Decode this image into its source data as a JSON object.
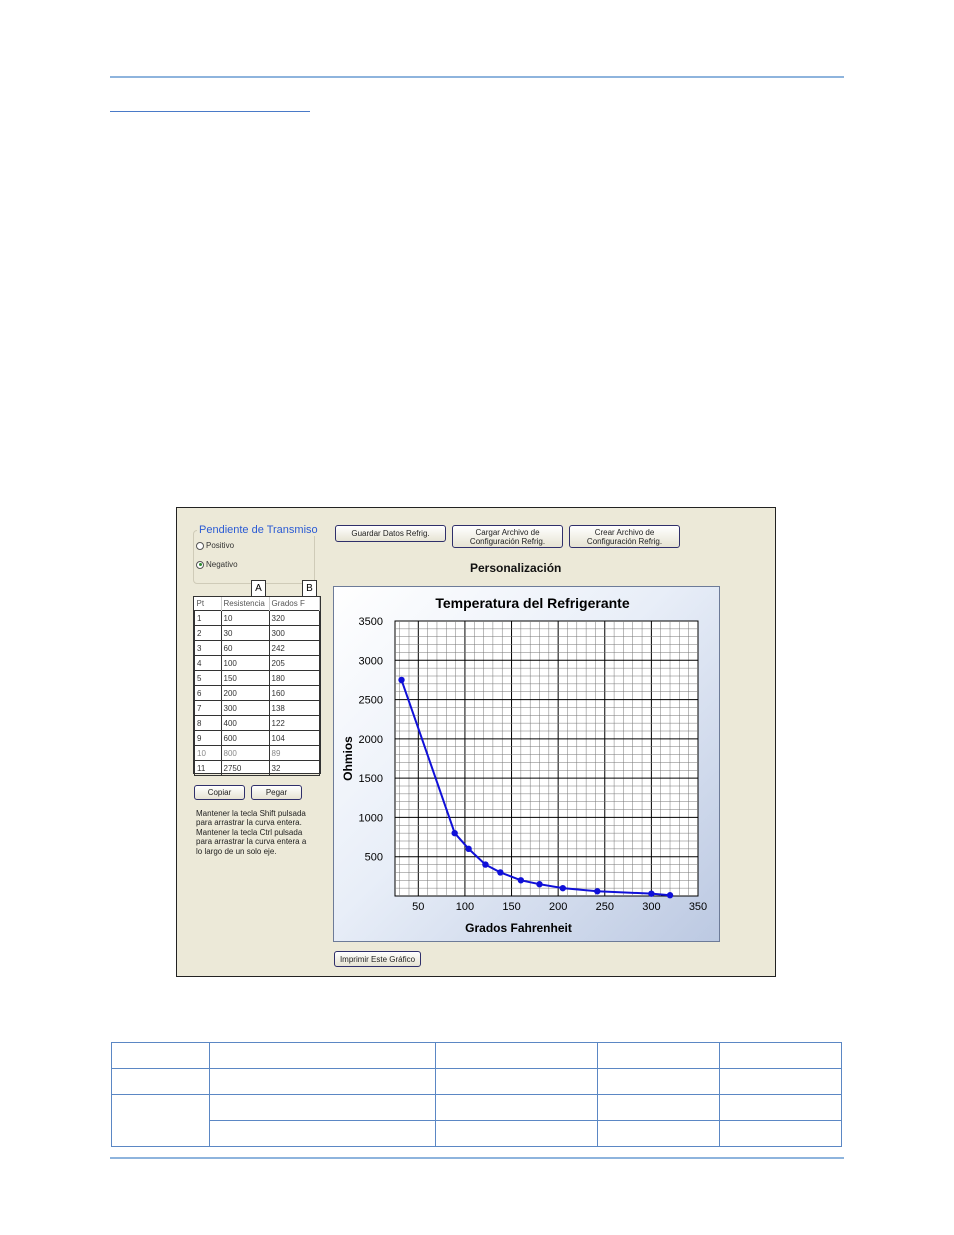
{
  "app": {
    "slope_group": {
      "title": "Pendiente de Transmiso",
      "options": [
        {
          "label": "Positivo",
          "checked": false
        },
        {
          "label": "Negativo",
          "checked": true
        }
      ]
    },
    "column_tags": [
      "A",
      "B"
    ],
    "table": {
      "headers": [
        "Pt",
        "Resistencia",
        "Grados F"
      ],
      "rows": [
        {
          "pt": "1",
          "res": "10",
          "deg": "320"
        },
        {
          "pt": "2",
          "res": "30",
          "deg": "300"
        },
        {
          "pt": "3",
          "res": "60",
          "deg": "242"
        },
        {
          "pt": "4",
          "res": "100",
          "deg": "205"
        },
        {
          "pt": "5",
          "res": "150",
          "deg": "180"
        },
        {
          "pt": "6",
          "res": "200",
          "deg": "160"
        },
        {
          "pt": "7",
          "res": "300",
          "deg": "138"
        },
        {
          "pt": "8",
          "res": "400",
          "deg": "122"
        },
        {
          "pt": "9",
          "res": "600",
          "deg": "104"
        },
        {
          "pt": "10",
          "res": "800",
          "deg": "89"
        },
        {
          "pt": "11",
          "res": "2750",
          "deg": "32"
        }
      ]
    },
    "buttons": {
      "copy": "Copiar",
      "paste": "Pegar",
      "save": "Guardar Datos Refrig.",
      "load": "Cargar Archivo de Configuración Refrig.",
      "create": "Crear Archivo de Configuración Refrig.",
      "print": "Imprimir Este Gráfico"
    },
    "help_text": "Mantener la tecla Shift pulsada para arrastrar la curva entera. Mantener la tecla Ctrl pulsada para arrastrar la curva entera a lo largo de un solo eje.",
    "section_title": "Personalización"
  },
  "chart_data": {
    "type": "line",
    "title": "Temperatura del Refrigerante",
    "xlabel": "Grados Fahrenheit",
    "ylabel": "Ohmios",
    "xlim": [
      25,
      350
    ],
    "ylim": [
      0,
      3500
    ],
    "x_ticks": [
      50,
      100,
      150,
      200,
      250,
      300,
      350
    ],
    "y_ticks": [
      500,
      1000,
      1500,
      2000,
      2500,
      3000,
      3500
    ],
    "grid": true,
    "series": [
      {
        "color": "#1010d8",
        "points": [
          [
            32,
            2750
          ],
          [
            89,
            800
          ],
          [
            104,
            600
          ],
          [
            122,
            400
          ],
          [
            138,
            300
          ],
          [
            160,
            200
          ],
          [
            180,
            150
          ],
          [
            205,
            100
          ],
          [
            242,
            60
          ],
          [
            300,
            30
          ],
          [
            320,
            10
          ]
        ]
      }
    ]
  }
}
